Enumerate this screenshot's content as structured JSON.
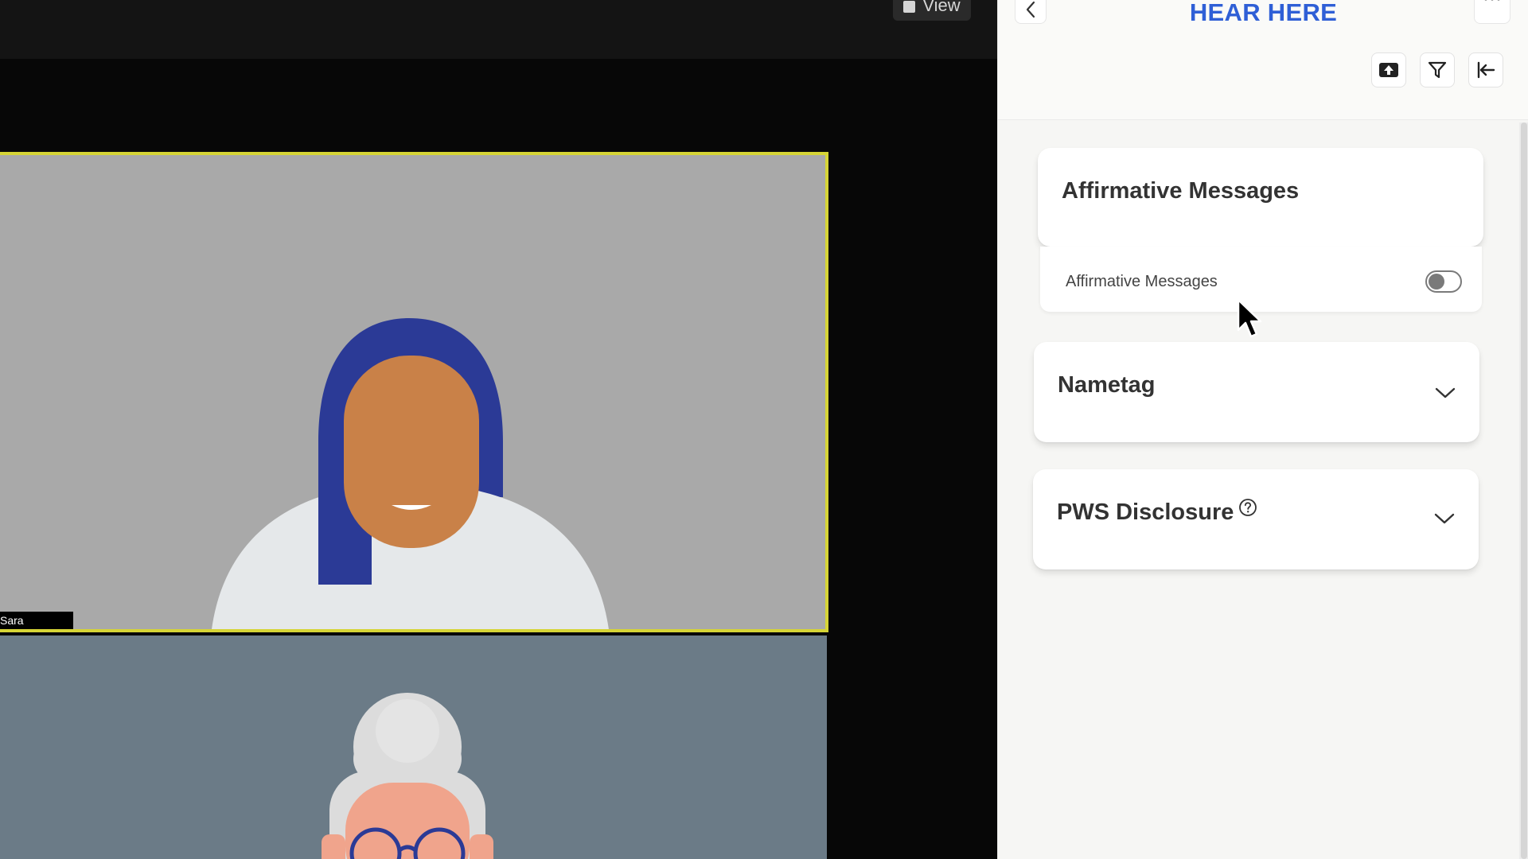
{
  "meeting": {
    "view_button_label": "View",
    "participants": [
      {
        "name": "Sara"
      },
      {
        "name": ""
      }
    ]
  },
  "panel": {
    "title": "HEAR HERE",
    "more_label": "···",
    "toolbar": [
      "upload-icon",
      "filter-icon",
      "collapse-left-icon"
    ],
    "sections": {
      "affirmative": {
        "title": "Affirmative Messages",
        "row_label": "Affirmative Messages",
        "toggle_on": false
      },
      "nametag": {
        "title": "Nametag",
        "expanded": false
      },
      "pws": {
        "title": "PWS Disclosure",
        "expanded": false,
        "help_icon": "question-circle-icon"
      }
    }
  },
  "colors": {
    "title_blue": "#2f5fd6",
    "active_speaker_border": "#d6d436",
    "tile_gray": "#a9a9a9",
    "tile_slate": "#6b7b87"
  }
}
